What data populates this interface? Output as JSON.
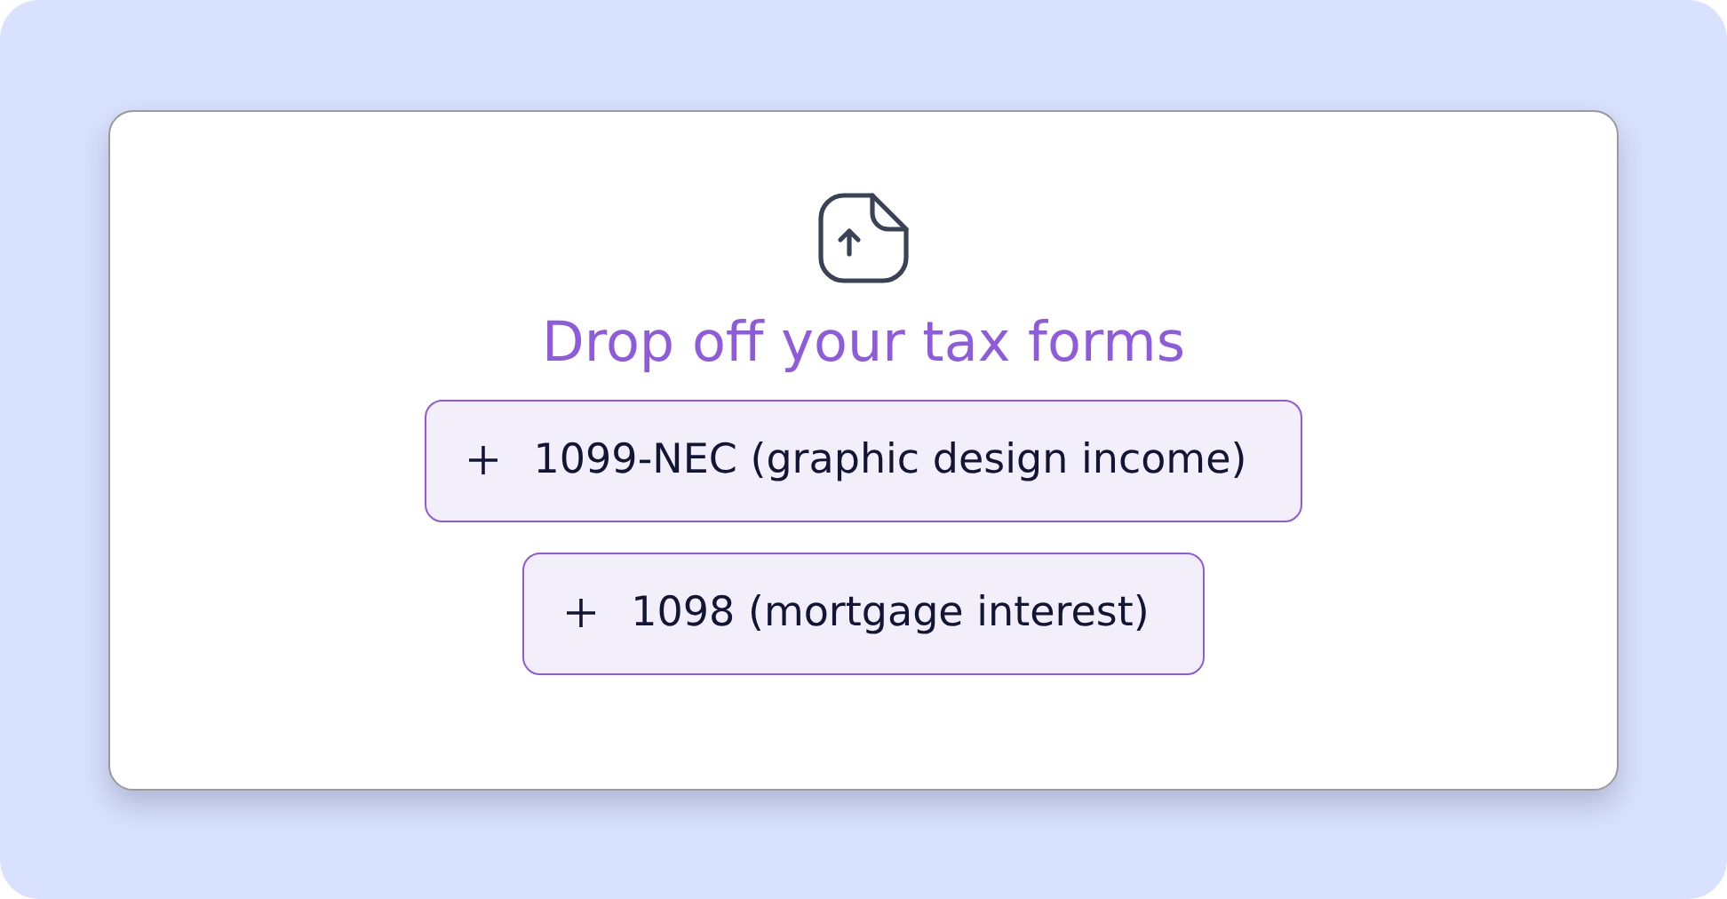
{
  "card": {
    "title": "Drop off your tax forms",
    "forms": [
      {
        "label": "1099-NEC (graphic design income)"
      },
      {
        "label": "1098 (mortgage interest)"
      }
    ]
  }
}
